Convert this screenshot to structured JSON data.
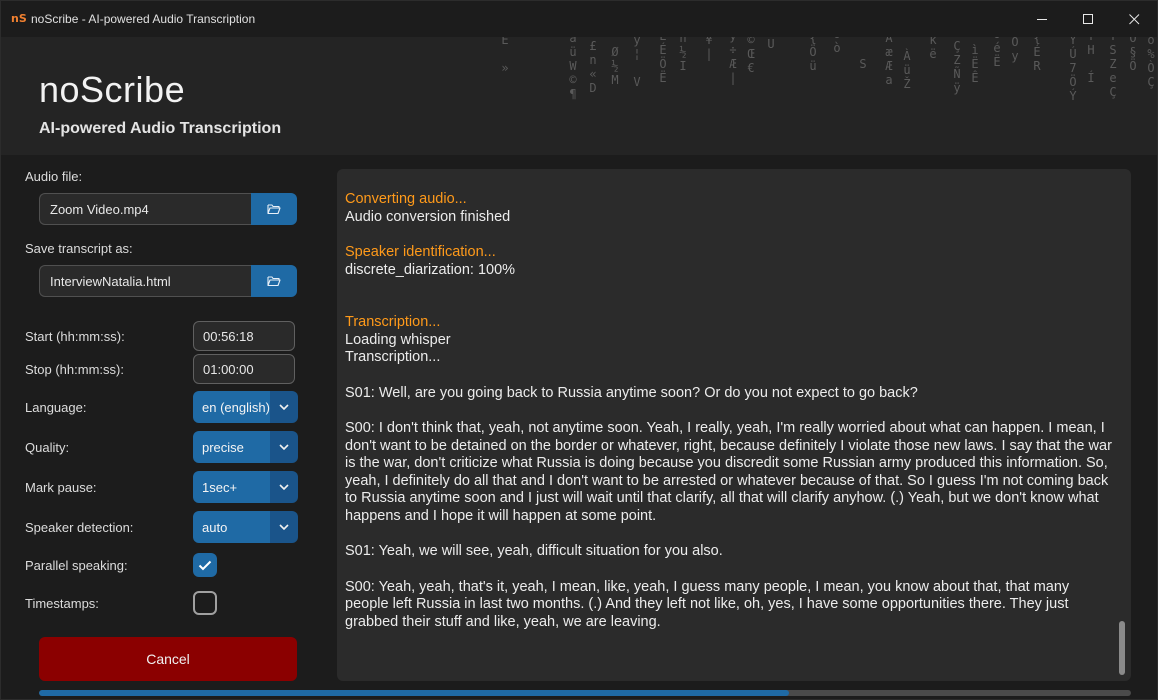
{
  "window": {
    "title": "noScribe - AI-powered Audio Transcription",
    "icon_text": "nS"
  },
  "header": {
    "app_name": "noScribe",
    "subtitle": "AI-powered Audio Transcription"
  },
  "sidebar": {
    "audio_file_label": "Audio file:",
    "audio_file_value": "Zoom Video.mp4",
    "save_label": "Save transcript as:",
    "save_value": "InterviewNatalia.html",
    "start_label": "Start (hh:mm:ss):",
    "start_value": "00:56:18",
    "stop_label": "Stop (hh:mm:ss):",
    "stop_value": "01:00:00",
    "language_label": "Language:",
    "language_value": "en (english)",
    "quality_label": "Quality:",
    "quality_value": "precise",
    "mark_pause_label": "Mark pause:",
    "mark_pause_value": "1sec+",
    "speaker_detection_label": "Speaker detection:",
    "speaker_detection_value": "auto",
    "parallel_label": "Parallel speaking:",
    "parallel_checked": true,
    "timestamps_label": "Timestamps:",
    "timestamps_checked": false,
    "cancel_label": "Cancel"
  },
  "log": {
    "converting": "Converting audio...",
    "conversion_done": "Audio conversion finished",
    "speaker_id": "Speaker identification...",
    "diarization": "discrete_diarization: 100%",
    "transcription_head": "Transcription...",
    "loading": "Loading whisper",
    "transcription_line": "Transcription...",
    "seg1": "S01: Well, are you going back to Russia anytime soon? Or do you not expect to go back?",
    "seg2": "S00: I don't think that, yeah, not anytime soon. Yeah, I really, yeah, I'm really worried about what can happen. I mean, I don't want to be detained on the border or whatever, right, because definitely I violate those new laws. I say that the war is the war, don't criticize what Russia is doing because you discredit some Russian army produced this information. So, yeah, I definitely do all that and I don't want to be arrested or whatever because of that. So I guess I'm not coming back to Russia anytime soon and I just will wait until that clarify, all that will clarify anyhow. (.) Yeah, but we don't know what happens and I hope it will happen at some point.",
    "seg3": "S01: Yeah, we will see, yeah, difficult situation for you also.",
    "seg4": "S00: Yeah, yeah, that's it, yeah, I mean, like, yeah, I guess many people, I mean, you know about that, that many people left Russia in last two months. (.) And they left not like, oh, yes, I have some opportunities there. They just grabbed their stuff and like, yeah, we are leaving."
  },
  "progress": {
    "fraction": 0.687
  },
  "colors": {
    "accent": "#1f6aa5",
    "log_heading": "#ff9a1a",
    "cancel": "#8b0000"
  }
}
